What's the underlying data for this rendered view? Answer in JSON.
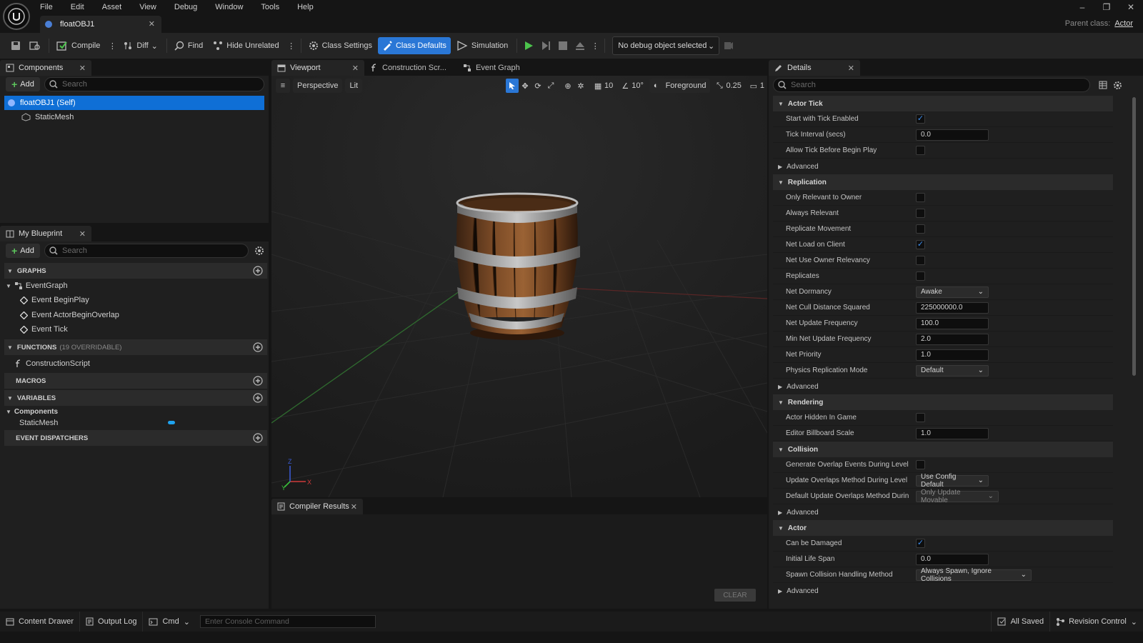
{
  "app": {
    "menu": [
      "File",
      "Edit",
      "Asset",
      "View",
      "Debug",
      "Window",
      "Tools",
      "Help"
    ],
    "doc_tab": "floatOBJ1",
    "parent_class_label": "Parent class:",
    "parent_class_value": "Actor"
  },
  "toolbar": {
    "compile": "Compile",
    "diff": "Diff",
    "find": "Find",
    "hide_unrelated": "Hide Unrelated",
    "class_settings": "Class Settings",
    "class_defaults": "Class Defaults",
    "simulation": "Simulation",
    "debug_object": "No debug object selected"
  },
  "components": {
    "tab": "Components",
    "add": "Add",
    "search_placeholder": "Search",
    "root": "floatOBJ1 (Self)",
    "child": "StaticMesh"
  },
  "my_blueprint": {
    "tab": "My Blueprint",
    "add": "Add",
    "search_placeholder": "Search",
    "graphs": "GRAPHS",
    "event_graph": "EventGraph",
    "events": [
      "Event BeginPlay",
      "Event ActorBeginOverlap",
      "Event Tick"
    ],
    "functions": "FUNCTIONS",
    "functions_note": "(19 OVERRIDABLE)",
    "construction_script": "ConstructionScript",
    "macros": "MACROS",
    "variables": "VARIABLES",
    "var_group": "Components",
    "var_item": "StaticMesh",
    "event_dispatchers": "EVENT DISPATCHERS"
  },
  "viewport": {
    "tabs": [
      "Viewport",
      "Construction Scr...",
      "Event Graph"
    ],
    "perspective": "Perspective",
    "lit": "Lit",
    "grid_snap": "10",
    "rot_snap": "10°",
    "foreground": "Foreground",
    "scale_snap": "0.25",
    "camera_speed": "1"
  },
  "compiler": {
    "tab": "Compiler Results",
    "clear": "CLEAR"
  },
  "details": {
    "tab": "Details",
    "search_placeholder": "Search",
    "actor_tick": "Actor Tick",
    "start_with_tick": "Start with Tick Enabled",
    "tick_interval": "Tick Interval (secs)",
    "tick_interval_val": "0.0",
    "allow_tick": "Allow Tick Before Begin Play",
    "advanced": "Advanced",
    "replication": "Replication",
    "only_relevant": "Only Relevant to Owner",
    "always_relevant": "Always Relevant",
    "replicate_movement": "Replicate Movement",
    "net_load": "Net Load on Client",
    "net_use_owner": "Net Use Owner Relevancy",
    "replicates": "Replicates",
    "net_dormancy": "Net Dormancy",
    "net_dormancy_val": "Awake",
    "net_cull": "Net Cull Distance Squared",
    "net_cull_val": "225000000.0",
    "net_update": "Net Update Frequency",
    "net_update_val": "100.0",
    "min_net_update": "Min Net Update Frequency",
    "min_net_update_val": "2.0",
    "net_priority": "Net Priority",
    "net_priority_val": "1.0",
    "phys_rep": "Physics Replication Mode",
    "phys_rep_val": "Default",
    "rendering": "Rendering",
    "actor_hidden": "Actor Hidden In Game",
    "billboard": "Editor Billboard Scale",
    "billboard_val": "1.0",
    "collision": "Collision",
    "gen_overlap": "Generate Overlap Events During Level S...",
    "update_overlap": "Update Overlaps Method During Level S...",
    "update_overlap_val": "Use Config Default",
    "default_update": "Default Update Overlaps Method During...",
    "default_update_val": "Only Update Movable",
    "actor": "Actor",
    "can_be_damaged": "Can be Damaged",
    "life_span": "Initial Life Span",
    "life_span_val": "0.0",
    "spawn_collision": "Spawn Collision Handling Method",
    "spawn_collision_val": "Always Spawn, Ignore Collisions"
  },
  "statusbar": {
    "content_drawer": "Content Drawer",
    "output_log": "Output Log",
    "cmd": "Cmd",
    "console_placeholder": "Enter Console Command",
    "all_saved": "All Saved",
    "revision_control": "Revision Control"
  },
  "colors": {
    "accent": "#2a77d6",
    "selection": "#0f6fd6",
    "play": "#4cc44c"
  }
}
